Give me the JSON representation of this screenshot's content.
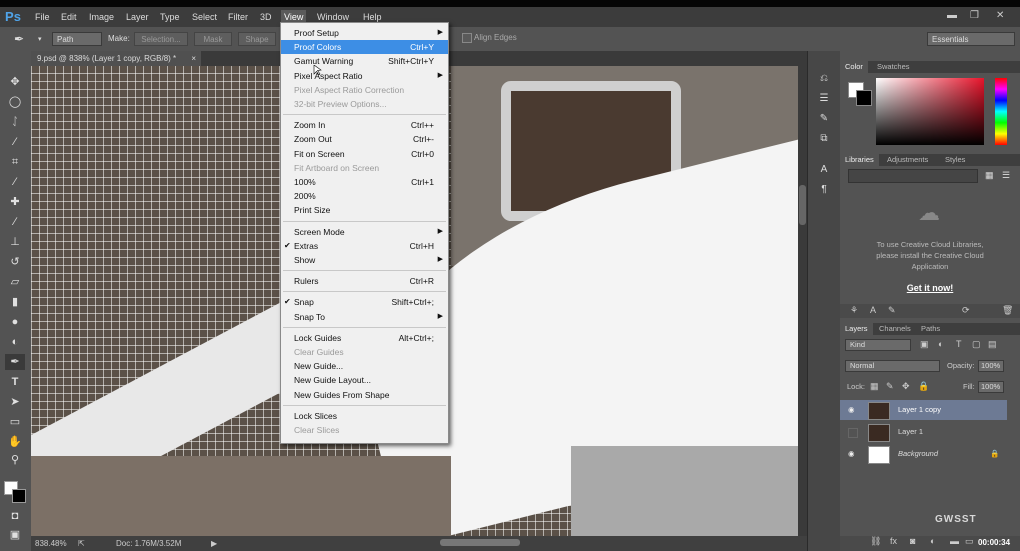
{
  "menubar": {
    "logo": "Ps",
    "items": [
      "File",
      "Edit",
      "Image",
      "Layer",
      "Type",
      "Select",
      "Filter",
      "3D",
      "View",
      "Window",
      "Help"
    ],
    "window_controls": [
      "▬",
      "❐",
      "✕"
    ]
  },
  "options": {
    "mode_value": "Path",
    "make_label": "Make:",
    "selection_btn": "Selection...",
    "mask_btn": "Mask",
    "shape_btn": "Shape",
    "align_edges": "Align Edges",
    "workspace": "Essentials"
  },
  "document": {
    "tab_title": "9.psd @ 838% (Layer 1 copy, RGB/8) *",
    "zoom": "838.48%",
    "doc_size": "Doc: 1.76M/3.52M"
  },
  "view_menu": {
    "items": [
      {
        "label": "Proof Setup",
        "arrow": true
      },
      {
        "label": "Proof Colors",
        "shortcut": "Ctrl+Y",
        "highlight": true
      },
      {
        "label": "Gamut Warning",
        "shortcut": "Shift+Ctrl+Y"
      },
      {
        "label": "Pixel Aspect Ratio",
        "arrow": true
      },
      {
        "label": "Pixel Aspect Ratio Correction",
        "disabled": true
      },
      {
        "label": "32-bit Preview Options...",
        "disabled": true
      },
      {
        "label": "Zoom In",
        "shortcut": "Ctrl++"
      },
      {
        "label": "Zoom Out",
        "shortcut": "Ctrl+-"
      },
      {
        "label": "Fit on Screen",
        "shortcut": "Ctrl+0"
      },
      {
        "label": "Fit Artboard on Screen",
        "disabled": true
      },
      {
        "label": "100%",
        "shortcut": "Ctrl+1"
      },
      {
        "label": "200%"
      },
      {
        "label": "Print Size"
      },
      {
        "label": "Screen Mode",
        "arrow": true
      },
      {
        "label": "Extras",
        "shortcut": "Ctrl+H",
        "checked": true
      },
      {
        "label": "Show",
        "arrow": true
      },
      {
        "label": "Rulers",
        "shortcut": "Ctrl+R"
      },
      {
        "label": "Snap",
        "shortcut": "Shift+Ctrl+;",
        "checked": true
      },
      {
        "label": "Snap To",
        "arrow": true
      },
      {
        "label": "Lock Guides",
        "shortcut": "Alt+Ctrl+;"
      },
      {
        "label": "Clear Guides",
        "disabled": true
      },
      {
        "label": "New Guide..."
      },
      {
        "label": "New Guide Layout..."
      },
      {
        "label": "New Guides From Shape"
      },
      {
        "label": "Lock Slices"
      },
      {
        "label": "Clear Slices",
        "disabled": true
      }
    ]
  },
  "color_panel": {
    "tabs": [
      "Color",
      "Swatches"
    ]
  },
  "libraries_panel": {
    "tabs": [
      "Libraries",
      "Adjustments",
      "Styles"
    ],
    "message_line1": "To use Creative Cloud Libraries,",
    "message_line2": "please install the Creative Cloud",
    "message_line3": "Application",
    "link": "Get it now!"
  },
  "layers_panel": {
    "tabs": [
      "Layers",
      "Channels",
      "Paths"
    ],
    "filter": "Kind",
    "blend_mode": "Normal",
    "opacity_label": "Opacity:",
    "opacity_value": "100%",
    "lock_label": "Lock:",
    "fill_label": "Fill:",
    "fill_value": "100%",
    "layers": [
      {
        "name": "Layer 1 copy",
        "selected": true,
        "visible": true
      },
      {
        "name": "Layer 1",
        "selected": false,
        "visible": false
      },
      {
        "name": "Background",
        "selected": false,
        "visible": true,
        "locked": true
      }
    ]
  },
  "watermark": "GWSST",
  "timer": "00:00:34",
  "colors": {
    "accent": "#3d8ee5",
    "menubar": "#3c3c3c",
    "panel": "#535353"
  }
}
